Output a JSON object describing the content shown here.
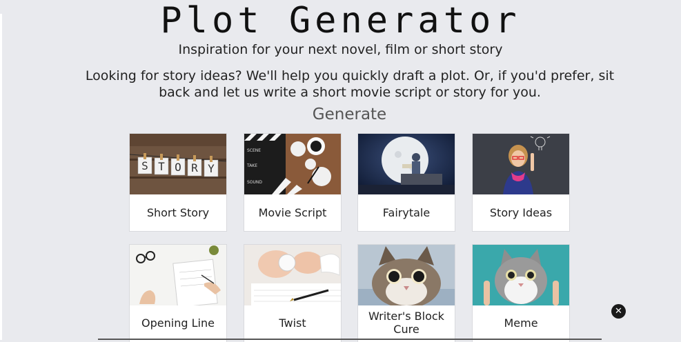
{
  "header": {
    "title": "Plot Generator",
    "subtitle": "Inspiration for your next novel, film or short story",
    "intro": "Looking for story ideas? We'll help you quickly draft a plot. Or, if you'd prefer, sit back and let us write a short movie script or story for you."
  },
  "generate": {
    "heading": "Generate",
    "cards": [
      {
        "label": "Short Story"
      },
      {
        "label": "Movie Script"
      },
      {
        "label": "Fairytale"
      },
      {
        "label": "Story Ideas"
      },
      {
        "label": "Opening Line"
      },
      {
        "label": "Twist"
      },
      {
        "label": "Writer's Block Cure"
      },
      {
        "label": "Meme"
      }
    ]
  },
  "thumb_text": {
    "story_letters": [
      "S",
      "T",
      "O",
      "R",
      "Y"
    ],
    "clapper_words": [
      "SCENE",
      "TAKE",
      "SOUND"
    ]
  },
  "overlay": {
    "close_glyph": "✕"
  },
  "colors": {
    "background": "#e9eaee",
    "card": "#ffffff",
    "text": "#222222",
    "heading": "#555555"
  }
}
